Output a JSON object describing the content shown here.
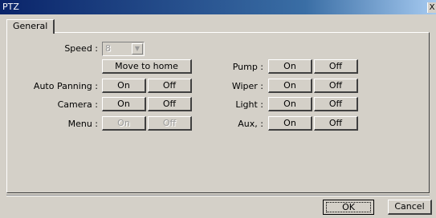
{
  "window": {
    "title": "PTZ",
    "close_glyph": "X"
  },
  "tabs": [
    {
      "label": "General"
    }
  ],
  "speed": {
    "label": "Speed :",
    "value": "8"
  },
  "move_home": {
    "label": "Move to home"
  },
  "left_rows": [
    {
      "label": "Auto Panning :",
      "on": "On",
      "off": "Off"
    },
    {
      "label": "Camera :",
      "on": "On",
      "off": "Off"
    },
    {
      "label": "Menu :",
      "on": "On",
      "off": "Off"
    }
  ],
  "right_rows": [
    {
      "label": "Pump :",
      "on": "On",
      "off": "Off"
    },
    {
      "label": "Wiper :",
      "on": "On",
      "off": "Off"
    },
    {
      "label": "Light :",
      "on": "On",
      "off": "Off"
    },
    {
      "label": "Aux, :",
      "on": "On",
      "off": "Off"
    }
  ],
  "footer": {
    "ok": "OK",
    "cancel": "Cancel"
  }
}
